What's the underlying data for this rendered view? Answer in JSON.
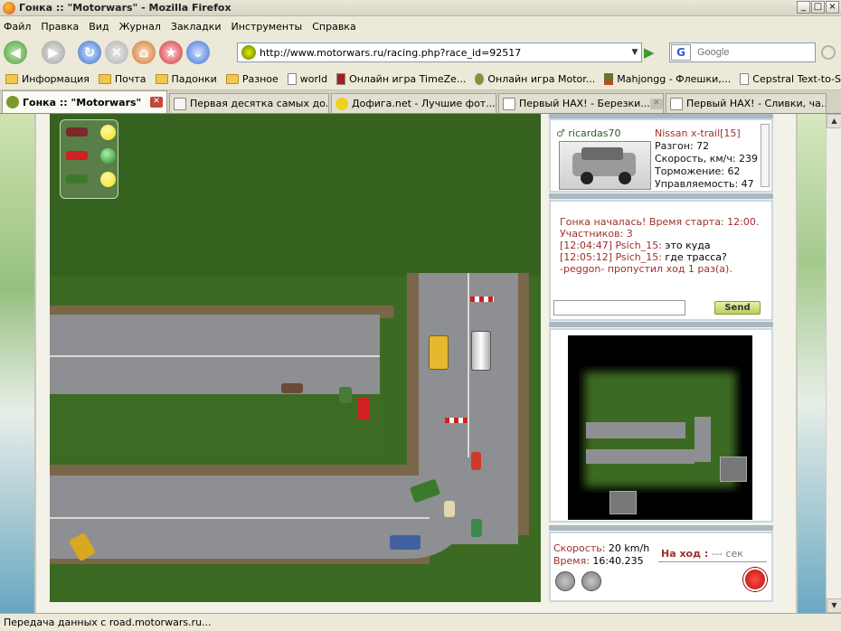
{
  "window": {
    "title": "Гонка :: \"Motorwars\" - Mozilla Firefox",
    "controls": [
      "_",
      "□",
      "×"
    ]
  },
  "menu": [
    "Файл",
    "Правка",
    "Вид",
    "Журнал",
    "Закладки",
    "Инструменты",
    "Справка"
  ],
  "nav": {
    "url": "http://www.motorwars.ru/racing.php?race_id=92517",
    "search_placeholder": "Google",
    "search_engine": "G"
  },
  "bookmarks": [
    {
      "label": "Информация",
      "icon": "folder-icon"
    },
    {
      "label": "Почта",
      "icon": "folder-icon"
    },
    {
      "label": "Падонки",
      "icon": "folder-icon"
    },
    {
      "label": "Разное",
      "icon": "folder-icon"
    },
    {
      "label": "world",
      "icon": "page-icon"
    },
    {
      "label": "Онлайн игра TimeZe...",
      "icon": "page-icon"
    },
    {
      "label": "Онлайн игра Motor...",
      "icon": "page-icon"
    },
    {
      "label": "Mahjongg - Флешки,...",
      "icon": "page-icon"
    },
    {
      "label": "Cepstral Text-to-Spe...",
      "icon": "page-icon"
    }
  ],
  "bookmarks_more": "»",
  "tabs": [
    {
      "label": "Гонка :: \"Motorwars\"",
      "active": true
    },
    {
      "label": "Первая десятка самых до...",
      "active": false
    },
    {
      "label": "Дофига.net - Лучшие фот...",
      "active": false
    },
    {
      "label": "Первый НАХ! - Березки...",
      "active": false
    },
    {
      "label": "Первый НАХ! - Сливки, ча...",
      "active": false
    }
  ],
  "car_info": {
    "user": "ricardas70",
    "car_name": "Nissan x-trail[15]",
    "stats": [
      "Разгон: 72",
      "Скорость, км/ч: 239",
      "Торможение: 62",
      "Управляемость: 47"
    ]
  },
  "chat": {
    "messages": [
      {
        "type": "sys",
        "text": "Гонка началась! Время старта: 12:00."
      },
      {
        "type": "sys",
        "text": "Участников: 3"
      },
      {
        "type": "msg",
        "time": "[12:04:47] Psich_15:",
        "text": " это куда"
      },
      {
        "type": "msg",
        "time": "[12:05:12] Psich_15:",
        "text": " где трасса?"
      },
      {
        "type": "sys",
        "text": "-peggon- пропустил ход 1 раз(а)."
      }
    ],
    "input_value": "",
    "send_label": "Send"
  },
  "status": {
    "speed_label": "Скорость:",
    "speed_value": "20 km/h",
    "time_label": "Время:",
    "time_value": "16:40.235",
    "turn_label": "На ход :",
    "turn_value": "--- сек"
  },
  "traffic_light": {
    "lamps": [
      "#f0e020",
      "#3aa83a",
      "#f0e020"
    ],
    "cars": [
      "#7a2a2a",
      "#d02020",
      "#3a7a2a"
    ]
  },
  "statusbar": "Передача данных с road.motorwars.ru..."
}
